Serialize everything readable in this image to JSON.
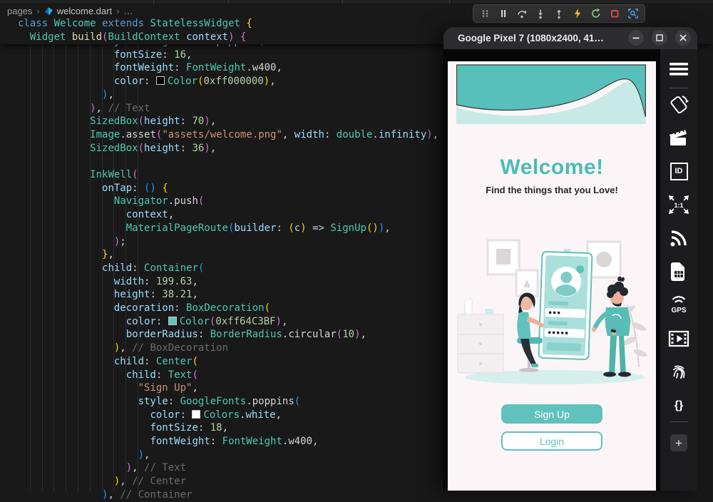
{
  "colors": {
    "editor_bg": "#191919",
    "code_keyword": "#569CD6",
    "code_class": "#4EC9B0",
    "code_function": "#DCDCAA",
    "code_property": "#9CDCFE",
    "code_number": "#B5CEA8",
    "code_string": "#CE9178",
    "code_comment": "#6b6b6b",
    "bracket_gold": "#FFD700",
    "bracket_pink": "#D670D6",
    "bracket_blue": "#179FFF",
    "hot_reload_yellow": "#FFB52E",
    "restart_green": "#89D185",
    "stop_red": "#F14C4C",
    "inspect_blue": "#4DAAFC",
    "accent_teal": "#5FC2BC",
    "welcome_teal": "#4CBCB6"
  },
  "breadcrumb": {
    "folder": "pages",
    "file": "welcome.dart",
    "more": "…"
  },
  "debug_toolbar": {
    "icons": [
      "gripper-icon",
      "pause-icon",
      "step-over-icon",
      "step-into-icon",
      "step-out-icon",
      "hot-reload-icon",
      "restart-icon",
      "stop-icon",
      "widget-inspector-icon"
    ]
  },
  "editor": {
    "sticky_lines": [
      {
        "indent": 0,
        "seg": [
          [
            "class ",
            "kw"
          ],
          [
            "Welcome ",
            "cls"
          ],
          [
            "extends ",
            "kw"
          ],
          [
            "StatelessWidget ",
            "cls"
          ],
          [
            "{",
            "bg"
          ]
        ]
      },
      {
        "indent": 2,
        "seg": [
          [
            "Widget",
            "cls"
          ],
          [
            " ",
            "pun"
          ],
          [
            "build",
            "fn"
          ],
          [
            "(",
            "bp"
          ],
          [
            "BuildContext",
            "cls"
          ],
          [
            " ",
            "pun"
          ],
          [
            "context",
            "prop"
          ],
          [
            ")",
            "bp"
          ],
          [
            " ",
            "pun"
          ],
          [
            "{",
            "bp"
          ]
        ]
      }
    ],
    "code_lines": [
      {
        "indent": 14,
        "seg": [
          [
            "style",
            "prop"
          ],
          [
            ": ",
            "pun"
          ],
          [
            "GoogleFonts",
            "cls"
          ],
          [
            ".",
            "pun"
          ],
          [
            "poppins",
            "pun"
          ],
          [
            "(",
            "bb"
          ]
        ]
      },
      {
        "indent": 16,
        "seg": [
          [
            "fontSize",
            "prop"
          ],
          [
            ": ",
            "pun"
          ],
          [
            "16",
            "num"
          ],
          [
            ",",
            "pun"
          ]
        ]
      },
      {
        "indent": 16,
        "seg": [
          [
            "fontWeight",
            "prop"
          ],
          [
            ": ",
            "pun"
          ],
          [
            "FontWeight",
            "cls"
          ],
          [
            ".",
            "pun"
          ],
          [
            "w400",
            "pun"
          ],
          [
            ",",
            "pun"
          ]
        ]
      },
      {
        "indent": 16,
        "seg": [
          [
            "color",
            "prop"
          ],
          [
            ": ",
            "pun"
          ],
          [
            "",
            "swatch:#000000"
          ],
          [
            "Color",
            "cls"
          ],
          [
            "(",
            "bg"
          ],
          [
            "0xff000000",
            "num"
          ],
          [
            ")",
            "bg"
          ],
          [
            ",",
            "pun"
          ]
        ]
      },
      {
        "indent": 14,
        "seg": [
          [
            ")",
            "bb"
          ],
          [
            ",",
            "pun"
          ]
        ]
      },
      {
        "indent": 12,
        "seg": [
          [
            ")",
            "bp"
          ],
          [
            ", ",
            "pun"
          ],
          [
            "// Text",
            "cmt"
          ]
        ]
      },
      {
        "indent": 12,
        "seg": [
          [
            "SizedBox",
            "cls"
          ],
          [
            "(",
            "bp"
          ],
          [
            "height",
            "prop"
          ],
          [
            ": ",
            "pun"
          ],
          [
            "70",
            "num"
          ],
          [
            ")",
            "bp"
          ],
          [
            ",",
            "pun"
          ]
        ]
      },
      {
        "indent": 12,
        "seg": [
          [
            "Image",
            "cls"
          ],
          [
            ".",
            "pun"
          ],
          [
            "asset",
            "pun"
          ],
          [
            "(",
            "bp"
          ],
          [
            "\"assets/welcome.png\"",
            "str"
          ],
          [
            ", ",
            "pun"
          ],
          [
            "width",
            "prop"
          ],
          [
            ": ",
            "pun"
          ],
          [
            "double",
            "cls"
          ],
          [
            ".",
            "pun"
          ],
          [
            "infinity",
            "prop"
          ],
          [
            ")",
            "bp"
          ],
          [
            ",",
            "pun"
          ]
        ]
      },
      {
        "indent": 12,
        "seg": [
          [
            "SizedBox",
            "cls"
          ],
          [
            "(",
            "bp"
          ],
          [
            "height",
            "prop"
          ],
          [
            ": ",
            "pun"
          ],
          [
            "36",
            "num"
          ],
          [
            ")",
            "bp"
          ],
          [
            ",",
            "pun"
          ]
        ]
      },
      {
        "indent": 0,
        "seg": []
      },
      {
        "indent": 12,
        "seg": [
          [
            "InkWell",
            "cls"
          ],
          [
            "(",
            "bp"
          ]
        ]
      },
      {
        "indent": 14,
        "seg": [
          [
            "onTap",
            "prop"
          ],
          [
            ": ",
            "pun"
          ],
          [
            "()",
            "bb"
          ],
          [
            " ",
            "pun"
          ],
          [
            "{",
            "bg"
          ]
        ]
      },
      {
        "indent": 16,
        "seg": [
          [
            "Navigator",
            "cls"
          ],
          [
            ".",
            "pun"
          ],
          [
            "push",
            "pun"
          ],
          [
            "(",
            "bp"
          ]
        ]
      },
      {
        "indent": 18,
        "seg": [
          [
            "context",
            "prop"
          ],
          [
            ",",
            "pun"
          ]
        ]
      },
      {
        "indent": 18,
        "seg": [
          [
            "MaterialPageRoute",
            "cls"
          ],
          [
            "(",
            "bb"
          ],
          [
            "builder",
            "prop"
          ],
          [
            ": ",
            "pun"
          ],
          [
            "(",
            "bg"
          ],
          [
            "c",
            "prop"
          ],
          [
            ")",
            "bg"
          ],
          [
            " => ",
            "pun"
          ],
          [
            "SignUp",
            "cls"
          ],
          [
            "(",
            "bg"
          ],
          [
            ")",
            "bg"
          ],
          [
            ")",
            "bb"
          ],
          [
            ",",
            "pun"
          ]
        ]
      },
      {
        "indent": 16,
        "seg": [
          [
            ")",
            "bp"
          ],
          [
            ";",
            "pun"
          ]
        ]
      },
      {
        "indent": 14,
        "seg": [
          [
            "}",
            "bg"
          ],
          [
            ",",
            "pun"
          ]
        ]
      },
      {
        "indent": 14,
        "seg": [
          [
            "child",
            "prop"
          ],
          [
            ": ",
            "pun"
          ],
          [
            "Container",
            "cls"
          ],
          [
            "(",
            "bb"
          ]
        ]
      },
      {
        "indent": 16,
        "seg": [
          [
            "width",
            "prop"
          ],
          [
            ": ",
            "pun"
          ],
          [
            "199.63",
            "num"
          ],
          [
            ",",
            "pun"
          ]
        ]
      },
      {
        "indent": 16,
        "seg": [
          [
            "height",
            "prop"
          ],
          [
            ": ",
            "pun"
          ],
          [
            "38.21",
            "num"
          ],
          [
            ",",
            "pun"
          ]
        ]
      },
      {
        "indent": 16,
        "seg": [
          [
            "decoration",
            "prop"
          ],
          [
            ": ",
            "pun"
          ],
          [
            "BoxDecoration",
            "cls"
          ],
          [
            "(",
            "bg"
          ]
        ]
      },
      {
        "indent": 18,
        "seg": [
          [
            "color",
            "prop"
          ],
          [
            ": ",
            "pun"
          ],
          [
            "",
            "swatch:#64C3BF"
          ],
          [
            "Color",
            "cls"
          ],
          [
            "(",
            "bp"
          ],
          [
            "0xff64C3BF",
            "num"
          ],
          [
            ")",
            "bp"
          ],
          [
            ",",
            "pun"
          ]
        ]
      },
      {
        "indent": 18,
        "seg": [
          [
            "borderRadius",
            "prop"
          ],
          [
            ": ",
            "pun"
          ],
          [
            "BorderRadius",
            "cls"
          ],
          [
            ".",
            "pun"
          ],
          [
            "circular",
            "pun"
          ],
          [
            "(",
            "bp"
          ],
          [
            "10",
            "num"
          ],
          [
            ")",
            "bp"
          ],
          [
            ",",
            "pun"
          ]
        ]
      },
      {
        "indent": 16,
        "seg": [
          [
            ")",
            "bg"
          ],
          [
            ", ",
            "pun"
          ],
          [
            "// BoxDecoration",
            "cmt"
          ]
        ]
      },
      {
        "indent": 16,
        "seg": [
          [
            "child",
            "prop"
          ],
          [
            ": ",
            "pun"
          ],
          [
            "Center",
            "cls"
          ],
          [
            "(",
            "bg"
          ]
        ]
      },
      {
        "indent": 18,
        "seg": [
          [
            "child",
            "prop"
          ],
          [
            ": ",
            "pun"
          ],
          [
            "Text",
            "cls"
          ],
          [
            "(",
            "bp"
          ]
        ]
      },
      {
        "indent": 20,
        "seg": [
          [
            "\"Sign Up\"",
            "str"
          ],
          [
            ",",
            "pun"
          ]
        ]
      },
      {
        "indent": 20,
        "seg": [
          [
            "style",
            "prop"
          ],
          [
            ": ",
            "pun"
          ],
          [
            "GoogleFonts",
            "cls"
          ],
          [
            ".",
            "pun"
          ],
          [
            "poppins",
            "pun"
          ],
          [
            "(",
            "bb"
          ]
        ]
      },
      {
        "indent": 22,
        "seg": [
          [
            "color",
            "prop"
          ],
          [
            ": ",
            "pun"
          ],
          [
            "",
            "swatch:#FFFFFF"
          ],
          [
            "Colors",
            "cls"
          ],
          [
            ".",
            "pun"
          ],
          [
            "white",
            "prop"
          ],
          [
            ",",
            "pun"
          ]
        ]
      },
      {
        "indent": 22,
        "seg": [
          [
            "fontSize",
            "prop"
          ],
          [
            ": ",
            "pun"
          ],
          [
            "18",
            "num"
          ],
          [
            ",",
            "pun"
          ]
        ]
      },
      {
        "indent": 22,
        "seg": [
          [
            "fontWeight",
            "prop"
          ],
          [
            ": ",
            "pun"
          ],
          [
            "FontWeight",
            "cls"
          ],
          [
            ".",
            "pun"
          ],
          [
            "w400",
            "pun"
          ],
          [
            ",",
            "pun"
          ]
        ]
      },
      {
        "indent": 20,
        "seg": [
          [
            ")",
            "bb"
          ],
          [
            ",",
            "pun"
          ]
        ]
      },
      {
        "indent": 18,
        "seg": [
          [
            ")",
            "bp"
          ],
          [
            ", ",
            "pun"
          ],
          [
            "// Text",
            "cmt"
          ]
        ]
      },
      {
        "indent": 16,
        "seg": [
          [
            ")",
            "bg"
          ],
          [
            ", ",
            "pun"
          ],
          [
            "// Center",
            "cmt"
          ]
        ]
      },
      {
        "indent": 14,
        "seg": [
          [
            ")",
            "bb"
          ],
          [
            ", ",
            "pun"
          ],
          [
            "// Container",
            "cmt"
          ]
        ]
      }
    ]
  },
  "emulator": {
    "title": "Google Pixel 7 (1080x2400, 41…",
    "window_controls": [
      "minimize",
      "maximize",
      "close"
    ],
    "sidebar_items": [
      {
        "name": "menu-icon"
      },
      {
        "name": "divider"
      },
      {
        "name": "rotate-device-icon"
      },
      {
        "name": "screenshot-icon"
      },
      {
        "name": "device-id-icon",
        "label": "ID"
      },
      {
        "name": "actual-size-icon",
        "label": "1:1"
      },
      {
        "name": "network-signal-icon"
      },
      {
        "name": "sim-card-icon"
      },
      {
        "name": "gps-icon",
        "label": "GPS"
      },
      {
        "name": "screen-record-icon"
      },
      {
        "name": "fingerprint-icon"
      },
      {
        "name": "developer-braces-icon",
        "label": "{}"
      },
      {
        "name": "divider"
      },
      {
        "name": "add-icon"
      }
    ],
    "app": {
      "title": "Welcome!",
      "subtitle": "Find the things that you Love!",
      "signup_label": "Sign Up",
      "login_label": "Login"
    }
  }
}
